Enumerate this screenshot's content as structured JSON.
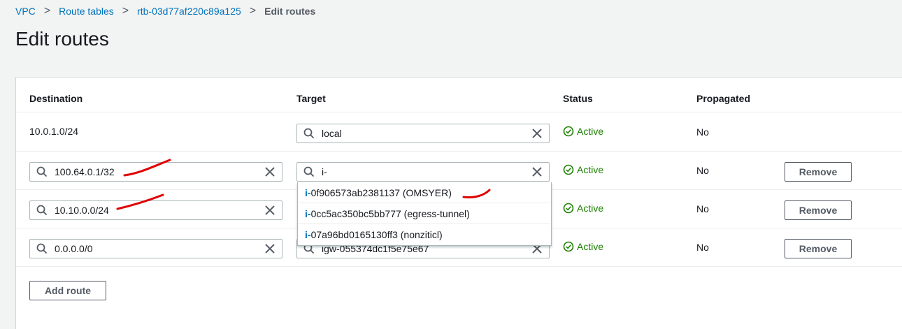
{
  "breadcrumb": {
    "vpc": "VPC",
    "route_tables": "Route tables",
    "route_table_id": "rtb-03d77af220c89a125",
    "current": "Edit routes",
    "separator": ">"
  },
  "page": {
    "title": "Edit routes"
  },
  "table": {
    "headers": {
      "destination": "Destination",
      "target": "Target",
      "status": "Status",
      "propagated": "Propagated"
    },
    "rows": [
      {
        "destination": "10.0.1.0/24",
        "target": "local",
        "status": "Active",
        "propagated": "No"
      },
      {
        "destination": "100.64.0.1/32",
        "target": "i-",
        "status": "Active",
        "propagated": "No",
        "remove": "Remove"
      },
      {
        "destination": "10.10.0.0/24",
        "target": "",
        "status": "Active",
        "propagated": "No",
        "remove": "Remove"
      },
      {
        "destination": "0.0.0.0/0",
        "target": "igw-055374dc1f5e75e67",
        "status": "Active",
        "propagated": "No",
        "remove": "Remove"
      }
    ]
  },
  "dropdown": {
    "items": [
      {
        "prefix": "i-",
        "rest": "0f906573ab2381137 (OMSYER)"
      },
      {
        "prefix": "i-",
        "rest": "0cc5ac350bc5bb777 (egress-tunnel)"
      },
      {
        "prefix": "i-",
        "rest": "07a96bd0165130ff3 (nonziticl)"
      }
    ]
  },
  "actions": {
    "add_route": "Add route"
  },
  "colors": {
    "link": "#0073bb",
    "active": "#1d8102",
    "annotation": "#e00000"
  }
}
